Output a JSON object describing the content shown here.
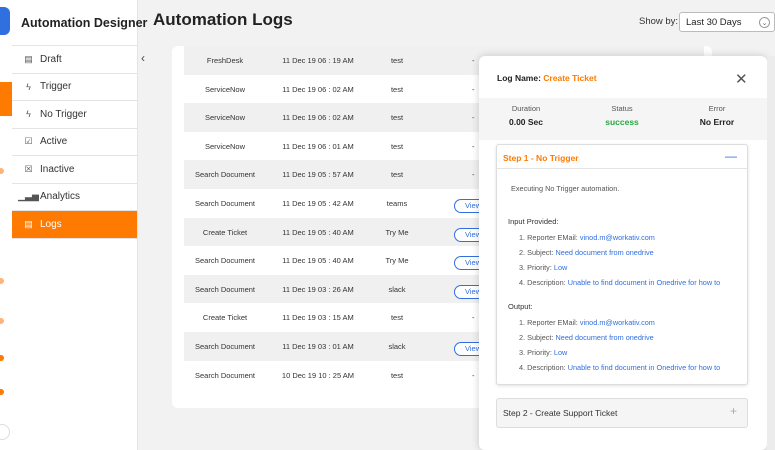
{
  "sidebar": {
    "title": "Automation Designer",
    "items": [
      {
        "label": "Draft",
        "icon": "draft-icon",
        "glyph": "▤",
        "active": false
      },
      {
        "label": "Trigger",
        "icon": "lightning-icon",
        "glyph": "ϟ",
        "active": false
      },
      {
        "label": "No Trigger",
        "icon": "lightning-off-icon",
        "glyph": "ϟ",
        "active": false
      },
      {
        "label": "Active",
        "icon": "checkbox-icon",
        "glyph": "☑",
        "active": false
      },
      {
        "label": "Inactive",
        "icon": "x-box-icon",
        "glyph": "☒",
        "active": false
      },
      {
        "label": "Analytics",
        "icon": "bar-chart-icon",
        "glyph": "▁▃▅",
        "active": false
      },
      {
        "label": "Logs",
        "icon": "logs-icon",
        "glyph": "▤",
        "active": true
      }
    ]
  },
  "header": {
    "title": "Automation Logs",
    "show_by_label": "Show by:",
    "show_by_value": "Last 30 Days"
  },
  "table": {
    "rows": [
      {
        "name": "FreshDesk",
        "date": "11 Dec 19 06 : 19 AM",
        "channel": "test",
        "action": "-",
        "shaded": true
      },
      {
        "name": "ServiceNow",
        "date": "11 Dec 19 06 : 02 AM",
        "channel": "test",
        "action": "-",
        "shaded": false
      },
      {
        "name": "ServiceNow",
        "date": "11 Dec 19 06 : 02 AM",
        "channel": "test",
        "action": "-",
        "shaded": true
      },
      {
        "name": "ServiceNow",
        "date": "11 Dec 19 06 : 01 AM",
        "channel": "test",
        "action": "-",
        "shaded": false
      },
      {
        "name": "Search Document",
        "date": "11 Dec 19 05 : 57 AM",
        "channel": "test",
        "action": "-",
        "shaded": true
      },
      {
        "name": "Search Document",
        "date": "11 Dec 19 05 : 42 AM",
        "channel": "teams",
        "action": "View",
        "shaded": false
      },
      {
        "name": "Create Ticket",
        "date": "11 Dec 19 05 : 40 AM",
        "channel": "Try Me",
        "action": "View",
        "shaded": true
      },
      {
        "name": "Search Document",
        "date": "11 Dec 19 05 : 40 AM",
        "channel": "Try Me",
        "action": "View",
        "shaded": false
      },
      {
        "name": "Search Document",
        "date": "11 Dec 19 03 : 26 AM",
        "channel": "slack",
        "action": "View",
        "shaded": true
      },
      {
        "name": "Create Ticket",
        "date": "11 Dec 19 03 : 15 AM",
        "channel": "test",
        "action": "-",
        "shaded": false
      },
      {
        "name": "Search Document",
        "date": "11 Dec 19 03 : 01 AM",
        "channel": "slack",
        "action": "View",
        "shaded": true
      },
      {
        "name": "Search Document",
        "date": "10 Dec 19 10 : 25 AM",
        "channel": "test",
        "action": "-",
        "shaded": false
      }
    ]
  },
  "log_panel": {
    "label": "Log Name:",
    "name": "Create Ticket",
    "duration_label": "Duration",
    "duration": "0.00 Sec",
    "status_label": "Status",
    "status": "success",
    "error_label": "Error",
    "error": "No Error",
    "step1": {
      "title": "Step 1 - No Trigger",
      "executing": "Executing No Trigger automation.",
      "input_label": "Input Provided:",
      "inputs": [
        {
          "n": "1.",
          "key": "Reporter EMail:",
          "value": "vinod.m@workativ.com"
        },
        {
          "n": "2.",
          "key": "Subject:",
          "value": "Need document from onedrive"
        },
        {
          "n": "3.",
          "key": "Priority:",
          "value": "Low"
        },
        {
          "n": "4.",
          "key": "Description:",
          "value": "Unable to find document in Onedrive for how to"
        }
      ],
      "output_label": "Output:",
      "outputs": [
        {
          "n": "1.",
          "key": "Reporter EMail:",
          "value": "vinod.m@workativ.com"
        },
        {
          "n": "2.",
          "key": "Subject:",
          "value": "Need document from onedrive"
        },
        {
          "n": "3.",
          "key": "Priority:",
          "value": "Low"
        },
        {
          "n": "4.",
          "key": "Description:",
          "value": "Unable to find document in Onedrive for how to"
        }
      ]
    },
    "step2": {
      "title": "Step 2 - Create Support Ticket"
    }
  },
  "colors": {
    "accent": "#ff7a00",
    "link": "#2f6fe0",
    "success": "#28a745"
  }
}
